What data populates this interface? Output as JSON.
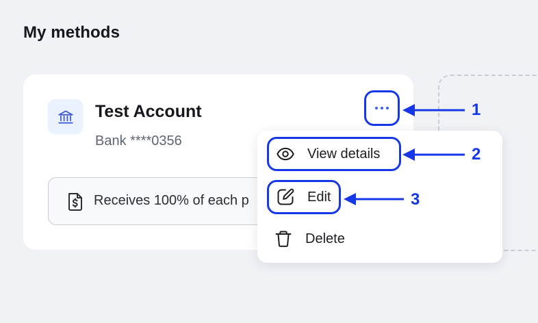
{
  "page": {
    "title": "My methods"
  },
  "account": {
    "name": "Test Account",
    "subtitle": "Bank ****0356",
    "bank_icon": "bank-icon",
    "receives_text": "Receives 100% of each p",
    "receives_icon": "dollar-document-icon",
    "more_icon": "more-horizontal-icon"
  },
  "menu": {
    "items": [
      {
        "label": "View details",
        "icon": "eye-icon"
      },
      {
        "label": "Edit",
        "icon": "edit-pencil-icon"
      },
      {
        "label": "Delete",
        "icon": "trash-icon"
      }
    ]
  },
  "annotations": {
    "callouts": [
      "1",
      "2",
      "3"
    ]
  },
  "colors": {
    "highlight": "#1537e8",
    "accent": "#3b5ff0",
    "background": "#f1f2f6"
  }
}
